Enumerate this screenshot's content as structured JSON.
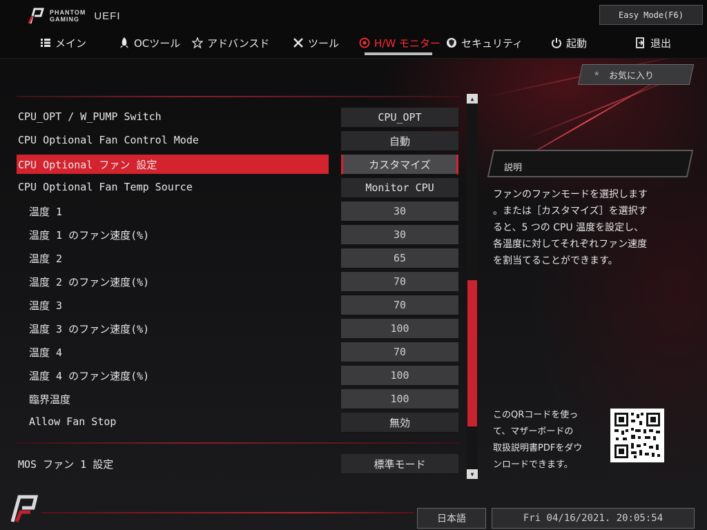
{
  "header": {
    "brand_line1": "PHANTOM",
    "brand_line2": "GAMING",
    "uefi": "UEFI",
    "easy_mode_label": "Easy Mode(F6)"
  },
  "nav": {
    "tabs": [
      {
        "label": "メイン",
        "icon": "list-icon"
      },
      {
        "label": "OCツール",
        "icon": "rocket-icon"
      },
      {
        "label": "アドバンスド",
        "icon": "star-icon"
      },
      {
        "label": "ツール",
        "icon": "tools-icon"
      },
      {
        "label": "H/W モニター",
        "icon": "monitor-icon",
        "active": true
      },
      {
        "label": "セキュリティ",
        "icon": "shield-icon"
      },
      {
        "label": "起動",
        "icon": "power-icon"
      },
      {
        "label": "退出",
        "icon": "exit-icon"
      }
    ]
  },
  "favorite": {
    "label": "お気に入り",
    "icon": "star-icon"
  },
  "settings": [
    {
      "label": "CPU_OPT / W_PUMP Switch",
      "value": "CPU_OPT"
    },
    {
      "label": "CPU Optional Fan Control Mode",
      "value": "自動"
    },
    {
      "label": "CPU Optional ファン 設定",
      "value": "カスタマイズ",
      "selected": true
    },
    {
      "label": "CPU Optional Fan Temp Source",
      "value": "Monitor CPU"
    },
    {
      "label": "温度 1",
      "value": "30",
      "indent": true,
      "numeric": true
    },
    {
      "label": "温度 1 のファン速度(%)",
      "value": "30",
      "indent": true,
      "numeric": true
    },
    {
      "label": "温度 2",
      "value": "65",
      "indent": true,
      "numeric": true
    },
    {
      "label": "温度 2 のファン速度(%)",
      "value": "70",
      "indent": true,
      "numeric": true
    },
    {
      "label": "温度 3",
      "value": "70",
      "indent": true,
      "numeric": true
    },
    {
      "label": "温度 3 のファン速度(%)",
      "value": "100",
      "indent": true,
      "numeric": true
    },
    {
      "label": "温度 4",
      "value": "70",
      "indent": true,
      "numeric": true
    },
    {
      "label": "温度 4 のファン速度(%)",
      "value": "100",
      "indent": true,
      "numeric": true
    },
    {
      "label": "臨界温度",
      "value": "100",
      "indent": true,
      "numeric": true
    },
    {
      "label": "Allow Fan Stop",
      "value": "無効",
      "indent": true
    }
  ],
  "mos_fan": {
    "label": "MOS ファン 1 設定",
    "value": "標準モード"
  },
  "description": {
    "title": "説明",
    "lines": [
      "ファンのファンモードを選択します",
      "。または［カスタマイズ］を選択す",
      "ると、5 つの CPU 温度を設定し、",
      "各温度に対してそれぞれファン速度",
      "を割当てることができます。"
    ]
  },
  "qr": {
    "lines": [
      "このQRコードを使っ",
      "て、マザーボードの",
      "取扱説明書PDFをダウ",
      "ンロードできます。"
    ]
  },
  "footer": {
    "language": "日本語",
    "datetime": "Fri 04/16/2021. 20:05:54"
  },
  "colors": {
    "accent": "#d3232f",
    "active_tab": "#ff2a35"
  }
}
